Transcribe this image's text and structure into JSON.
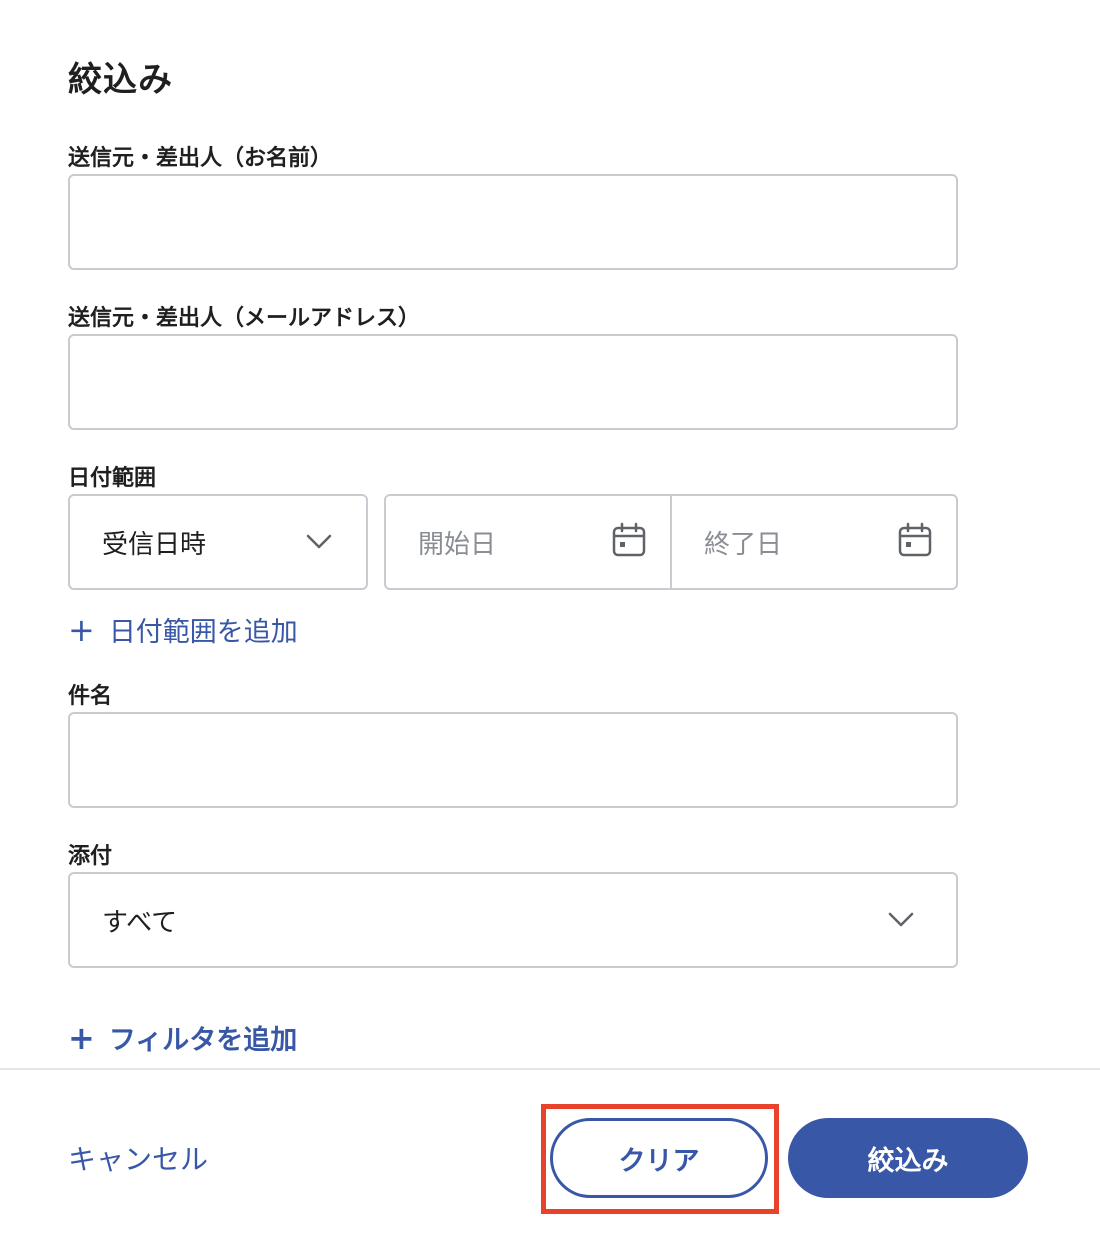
{
  "panel": {
    "title": "絞込み"
  },
  "fields": {
    "sender_name": {
      "label": "送信元・差出人（お名前）",
      "value": "",
      "placeholder": ""
    },
    "sender_email": {
      "label": "送信元・差出人（メールアドレス）",
      "value": "",
      "placeholder": ""
    },
    "date_range": {
      "label": "日付範囲",
      "type_selected": "受信日時",
      "start_placeholder": "開始日",
      "end_placeholder": "終了日",
      "add_label": "日付範囲を追加"
    },
    "subject": {
      "label": "件名",
      "value": "",
      "placeholder": ""
    },
    "attachment": {
      "label": "添付",
      "selected": "すべて"
    }
  },
  "add_filter_label": "フィルタを追加",
  "plus_symbol": "+",
  "footer": {
    "cancel_label": "キャンセル",
    "clear_label": "クリア",
    "apply_label": "絞込み"
  },
  "icons": {
    "dropdown": "chevron-down-icon",
    "calendar": "calendar-icon",
    "add": "plus-icon"
  },
  "colors": {
    "accent": "#3857a6",
    "border": "#c8cbd0",
    "highlight": "#e8412c",
    "placeholder": "#8a8e94"
  }
}
